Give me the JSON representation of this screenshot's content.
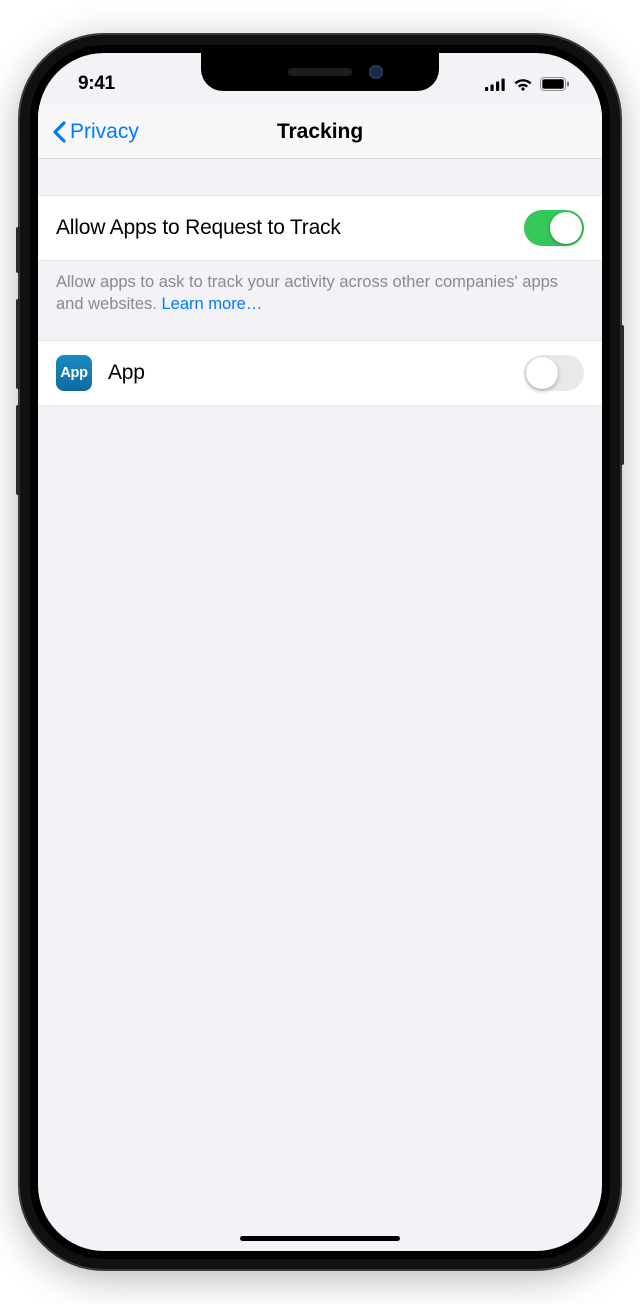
{
  "status": {
    "time": "9:41"
  },
  "nav": {
    "back_label": "Privacy",
    "title": "Tracking"
  },
  "settings": {
    "allow_request_label": "Allow Apps to Request to Track",
    "allow_request_on": true,
    "footer_text": "Allow apps to ask to track your activity across other companies' apps and websites. ",
    "learn_more_label": "Learn more…"
  },
  "apps": [
    {
      "icon_text": "App",
      "name": "App",
      "tracking_on": false
    }
  ]
}
